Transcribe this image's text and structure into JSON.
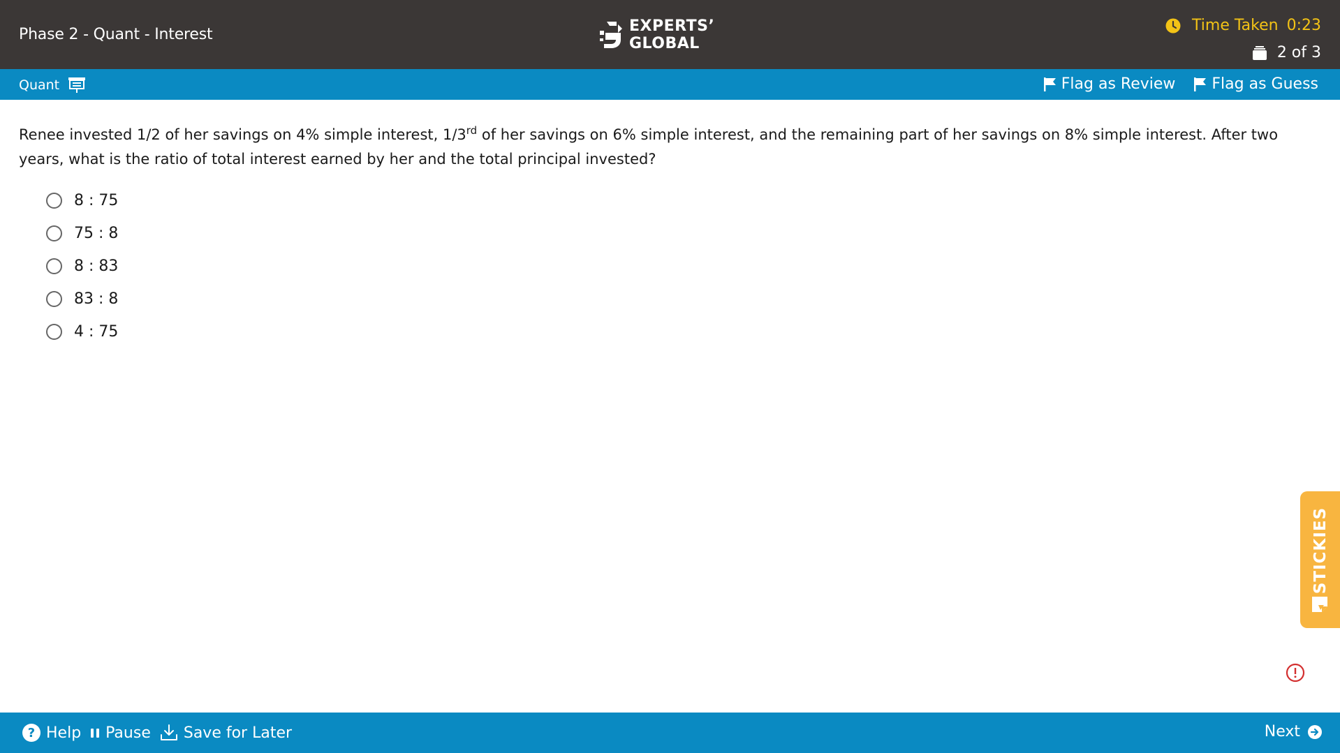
{
  "header": {
    "title": "Phase 2 - Quant - Interest",
    "logo_line1": "EXPERTS’",
    "logo_line2": "GLOBAL",
    "time_label": "Time Taken",
    "time_value": "0:23",
    "progress_text": "2 of 3",
    "accent_color": "#f3c316"
  },
  "section_bar": {
    "section_label": "Quant",
    "flag_review": "Flag as Review",
    "flag_guess": "Flag as Guess",
    "bar_color": "#0a8ac2"
  },
  "question": {
    "text_part1": "Renee invested 1/2 of her savings on 4% simple interest, 1/3",
    "superscript": "rd",
    "text_part2": " of her savings on 6% simple interest, and the remaining part of her savings on 8% simple interest. After two years, what is the ratio of total interest earned by her and the total principal invested?",
    "options": [
      "8 : 75",
      "75 : 8",
      "8 : 83",
      "83 : 8",
      "4 : 75"
    ]
  },
  "stickies": {
    "label": "STICKIES",
    "color": "#f8b540"
  },
  "footer": {
    "help": "Help",
    "pause": "Pause",
    "save": "Save for Later",
    "next": "Next"
  },
  "icons": [
    "logo-mark-icon",
    "clock-icon",
    "question-stack-icon",
    "presentation-icon",
    "flag-icon",
    "sticky-note-icon",
    "alert-icon",
    "help-icon",
    "pause-icon",
    "download-icon",
    "next-arrow-icon"
  ]
}
